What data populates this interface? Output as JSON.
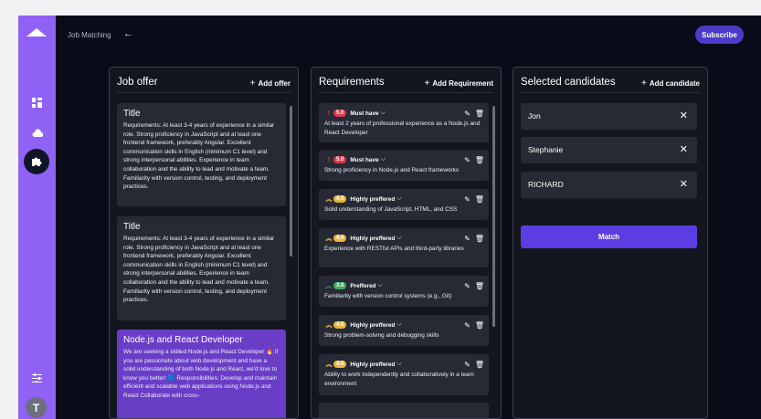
{
  "colors": {
    "sidebar": "#8f61f5",
    "background": "#090b18",
    "panel": "#14161f",
    "card": "#272a35",
    "selected_card": "#6a3dc7",
    "subscribe": "#4c3bc9",
    "match": "#5b3de3",
    "must_have": "#e0384c",
    "highly_preferred": "#e8b73a",
    "preferred": "#3fae63"
  },
  "sidebar": {
    "icons": [
      "logo-icon",
      "dashboard-icon",
      "cloud-icon",
      "puzzle-icon",
      "sliders-icon"
    ],
    "avatar_initial": "T"
  },
  "topbar": {
    "title": "Job Matching",
    "back_icon": "←",
    "subscribe_label": "Subscribe"
  },
  "job_offer": {
    "title": "Job offer",
    "add_label": "Add offer",
    "offers": [
      {
        "title": "Title",
        "description": "Requirements: At least 3-4 years of experience in a similar role. Strong proficiency in JavaScript and at least one frontend framework, preferably Angular. Excellent communication skills in English (minimum C1 level) and strong interpersonal abilities. Experience in team collaboration and the ability to lead and motivate a team. Familiarity with version control, testing, and deployment practices."
      },
      {
        "title": "Title",
        "description": "Requirements: At least 3-4 years of experience in a similar role. Strong proficiency in JavaScript and at least one frontend framework, preferably Angular. Excellent communication skills in English (minimum C1 level) and strong interpersonal abilities. Experience in team collaboration and the ability to lead and motivate a team. Familiarity with version control, testing, and deployment practices."
      },
      {
        "title": "Node.js and React Developer",
        "description": "We are seeking a skilled Node.js and React Developer 🔥 If you are passionate about web development and have a solid understanding of both Node.js and React, we'd love to know you better! 🟦 Responsibilities: Develop and maintain efficient and scalable web applications using Node.js and React Collaborate with cross-"
      }
    ]
  },
  "requirements": {
    "title": "Requirements",
    "add_label": "Add Requirement",
    "items": [
      {
        "icon": "!",
        "score": "5.0",
        "priority": "Must have",
        "text": "At least 2 years of professional experience as a Node.js and React Developer"
      },
      {
        "icon": "!",
        "score": "5.0",
        "priority": "Must have",
        "text": "Strong proficiency in Node.js and React frameworks"
      },
      {
        "icon": "︽",
        "score": "4.0",
        "priority": "Highly preffered",
        "text": "Solid understanding of JavaScript, HTML, and CSS"
      },
      {
        "icon": "︽",
        "score": "4.0",
        "priority": "Highly preffered",
        "text": "Experience with RESTful APIs and third-party libraries"
      },
      {
        "icon": "︿",
        "score": "3.0",
        "priority": "Preffered",
        "text": "Familiarity with version control systems (e.g., Git)"
      },
      {
        "icon": "︽",
        "score": "4.0",
        "priority": "Highly preffered",
        "text": "Strong problem-solving and debugging skills"
      },
      {
        "icon": "︽",
        "score": "4.0",
        "priority": "Highly preffered",
        "text": "Ability to work independently and collaboratively in a team environment"
      }
    ]
  },
  "candidates": {
    "title": "Selected candidates",
    "add_label": "Add candidate",
    "items": [
      {
        "name": "Jon"
      },
      {
        "name": "Stephanie"
      },
      {
        "name": "RICHARD"
      }
    ],
    "remove_icon": "✕",
    "match_label": "Match"
  }
}
